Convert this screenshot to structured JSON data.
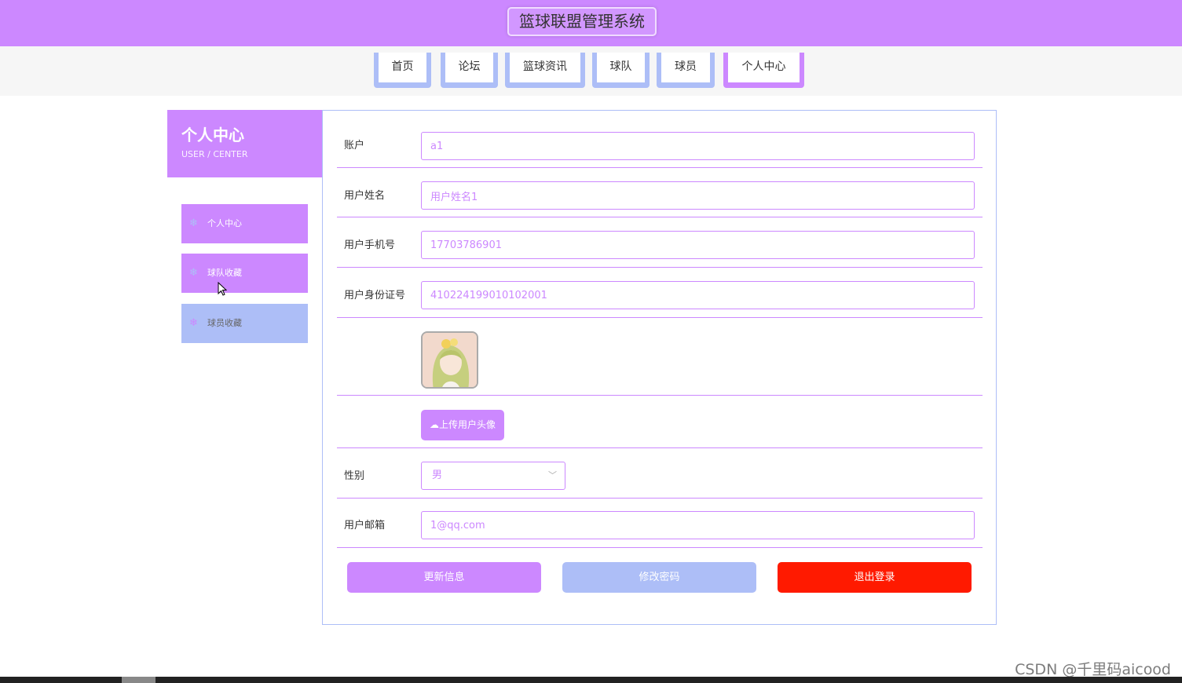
{
  "header": {
    "title": "篮球联盟管理系统"
  },
  "nav": {
    "items": [
      {
        "label": "首页"
      },
      {
        "label": "论坛"
      },
      {
        "label": "篮球资讯"
      },
      {
        "label": "球队"
      },
      {
        "label": "球员"
      },
      {
        "label": "个人中心",
        "active": true
      }
    ]
  },
  "sidebar": {
    "title": "个人中心",
    "subtitle": "USER / CENTER",
    "items": [
      {
        "label": "个人中心",
        "icon": "snowflake-icon"
      },
      {
        "label": "球队收藏",
        "icon": "snowflake-icon"
      },
      {
        "label": "球员收藏",
        "icon": "snowflake-icon"
      }
    ]
  },
  "form": {
    "account_label": "账户",
    "account_value": "a1",
    "name_label": "用户姓名",
    "name_value": "用户姓名1",
    "phone_label": "用户手机号",
    "phone_value": "17703786901",
    "idcard_label": "用户身份证号",
    "idcard_value": "410224199010102001",
    "upload_label": "上传用户头像",
    "gender_label": "性别",
    "gender_value": "男",
    "email_label": "用户邮箱",
    "email_value": "1@qq.com"
  },
  "actions": {
    "update_label": "更新信息",
    "password_label": "修改密码",
    "logout_label": "退出登录"
  },
  "colors": {
    "primary": "#cc88ff",
    "secondary": "#adbef7",
    "danger": "#ff1a00"
  },
  "watermark": "CSDN @千里码aicood"
}
